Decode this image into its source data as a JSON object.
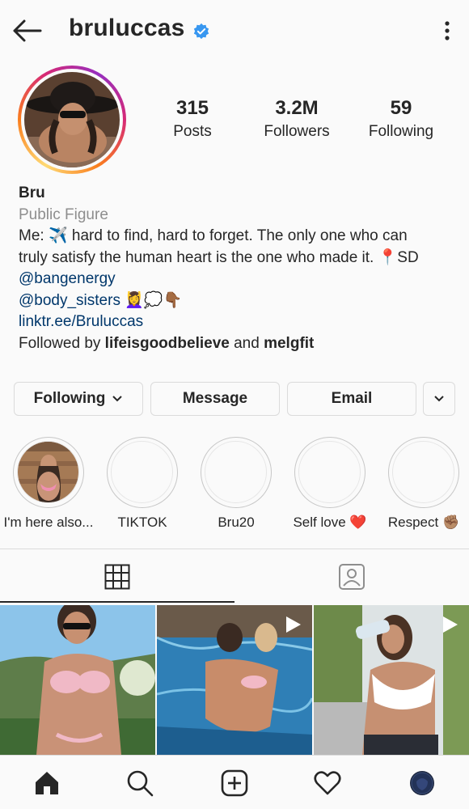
{
  "header": {
    "username": "bruluccas",
    "verified_color": "#3897f0",
    "back_icon": "arrow-left-icon",
    "menu_icon": "kebab-menu-icon"
  },
  "stats": [
    {
      "value": "315",
      "label": "Posts"
    },
    {
      "value": "3.2M",
      "label": "Followers"
    },
    {
      "value": "59",
      "label": "Following"
    }
  ],
  "bio": {
    "name": "Bru",
    "category": "Public Figure",
    "line1": "Me: ✈️ hard to find, hard to forget. The only one who can",
    "line2": "truly satisfy the human heart is the one who made it. 📍SD",
    "mention1": "@bangenergy",
    "mention2": "@body_sisters",
    "mention2_emoji": "💆‍♀️💭👇🏾",
    "link": "linktr.ee/Bruluccas",
    "followed_prefix": "Followed by ",
    "followed_user1": "lifeisgoodbelieve",
    "followed_and": " and ",
    "followed_user2": "melgfit"
  },
  "buttons": {
    "following": "Following",
    "message": "Message",
    "email": "Email"
  },
  "highlights": [
    {
      "label": "I'm here also..."
    },
    {
      "label": "TIKTOK"
    },
    {
      "label": "Bru20"
    },
    {
      "label": "Self love ❤️"
    },
    {
      "label": "Respect ✊🏽"
    }
  ],
  "tabs": {
    "grid_icon": "grid-icon",
    "tagged_icon": "tagged-person-icon"
  },
  "colors": {
    "text": "#262626",
    "muted": "#8e8e8e",
    "link": "#00376b",
    "border": "#dbdbdb"
  },
  "nav": [
    "home-icon",
    "search-icon",
    "new-post-icon",
    "heart-icon",
    "profile-avatar"
  ]
}
